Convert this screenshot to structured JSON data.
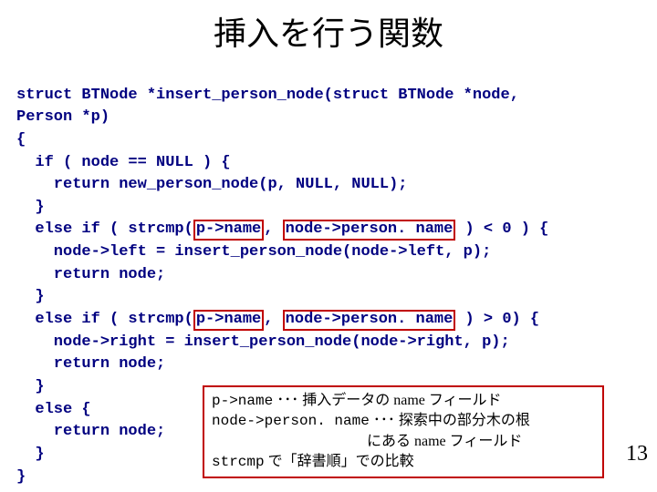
{
  "title": "挿入を行う関数",
  "code": {
    "l1": "struct BTNode *insert_person_node(struct BTNode *node,",
    "l2": "Person *p)",
    "l3": "{",
    "l4": "  if ( node == NULL ) {",
    "l5": "    return new_person_node(p, NULL, NULL);",
    "l6": "  }",
    "l7a": "  else if ( strcmp(",
    "hl1a": "p->name",
    "l7b": ", ",
    "hl1b": "node->person. name",
    "l7c": " ) < 0 ) {",
    "l8": "    node->left = insert_person_node(node->left, p);",
    "l9": "    return node;",
    "l10": "  }",
    "l11a": "  else if ( strcmp(",
    "hl2a": "p->name",
    "l11b": ", ",
    "hl2b": "node->person. name",
    "l11c": " ) > 0) {",
    "l12": "    node->right = insert_person_node(node->right, p);",
    "l13": "    return node;",
    "l14": "  }",
    "l15": "  else {",
    "l16": "    return node;",
    "l17": "  }",
    "l18": "}"
  },
  "annot": {
    "line1a": "p->name",
    "line1b": " ･･･ 挿入データの name フィールド",
    "line2a": "node->person. name",
    "line2b": " ･･･ 探索中の部分木の根",
    "line3": "にある name フィールド",
    "line4a": "strcmp",
    "line4b": " で「辞書順」での比較"
  },
  "pageNumber": "13"
}
